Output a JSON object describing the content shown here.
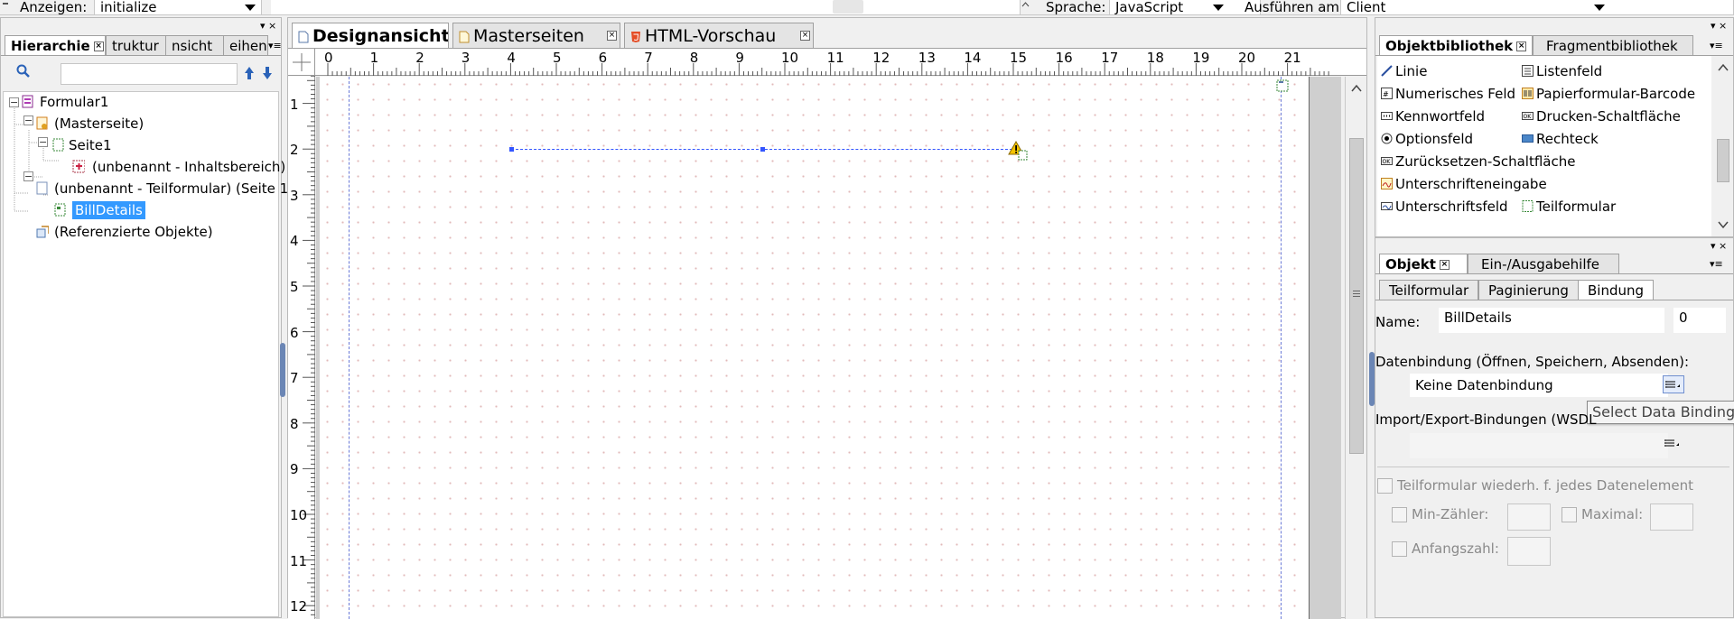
{
  "toolbar": {
    "show_label": "Anzeigen:",
    "show_value": "initialize",
    "language_label": "Sprache:",
    "language_value": "JavaScript",
    "run_label": "Ausführen am:",
    "run_value": "Client"
  },
  "hierarchy": {
    "tabs": [
      "Hierarchie",
      "truktur",
      "nsicht",
      "eihen"
    ],
    "tree": [
      {
        "label": "Formular1",
        "level": 0
      },
      {
        "label": "(Masterseite)",
        "level": 1
      },
      {
        "label": "Seite1",
        "level": 2
      },
      {
        "label": "(unbenannt - Inhaltsbereich)",
        "level": 3
      },
      {
        "label": "(unbenannt - Teilformular) (Seite 1)",
        "level": 1
      },
      {
        "label": "BillDetails",
        "level": 2,
        "selected": true
      },
      {
        "label": "(Referenzierte Objekte)",
        "level": 1
      }
    ]
  },
  "editor": {
    "tabs": [
      "Designansicht",
      "Masterseiten",
      "HTML-Vorschau"
    ],
    "ruler_h": [
      "0",
      "1",
      "2",
      "3",
      "4",
      "5",
      "6",
      "7",
      "8",
      "9",
      "10",
      "11",
      "12",
      "13",
      "14",
      "15",
      "16",
      "17",
      "18",
      "19",
      "20",
      "21"
    ],
    "ruler_v": [
      "1",
      "2",
      "3",
      "4",
      "5",
      "6",
      "7",
      "8",
      "9",
      "10",
      "11",
      "12"
    ]
  },
  "library": {
    "tabs": [
      "Objektbibliothek",
      "Fragmentbibliothek"
    ],
    "items": [
      [
        "Linie",
        "Listenfeld"
      ],
      [
        "Numerisches Feld",
        "Papierformular-Barcode"
      ],
      [
        "Kennwortfeld",
        "Drucken-Schaltfläche"
      ],
      [
        "Optionsfeld",
        "Rechteck"
      ],
      [
        "Zurücksetzen-Schaltfläche",
        ""
      ],
      [
        "Unterschrifteneingabe",
        ""
      ],
      [
        "Unterschriftsfeld",
        "Teilformular"
      ]
    ]
  },
  "object": {
    "tabs": [
      "Objekt",
      "Ein-/Ausgabehilfe"
    ],
    "subtabs": [
      "Teilformular",
      "Paginierung",
      "Bindung"
    ],
    "name_label": "Name:",
    "name_value": "BillDetails",
    "name_index": "0",
    "binding_label": "Datenbindung (Öffnen, Speichern, Absenden):",
    "binding_value": "Keine Datenbindung",
    "tooltip": "Select Data Binding",
    "import_label": "Import/Export-Bindungen (WSDL",
    "repeat_label": "Teilformular wiederh. f. jedes Datenelement",
    "min_label": "Min-Zähler:",
    "max_label": "Maximal:",
    "init_label": "Anfangszahl:"
  }
}
